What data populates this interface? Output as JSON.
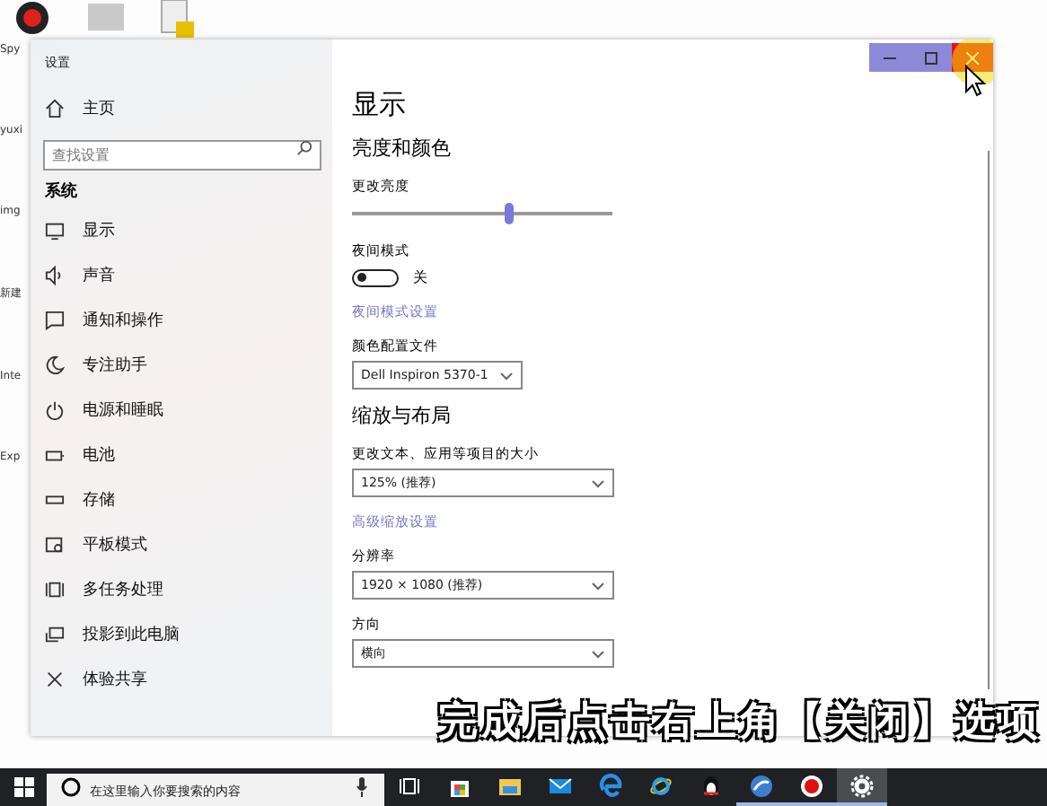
{
  "desktop": {
    "icon_labels": [
      "Spy",
      "yuxi",
      "img",
      "新建",
      "Inte",
      "Exp"
    ]
  },
  "window": {
    "title": "设置",
    "sidebar": {
      "home": "主页",
      "search_placeholder": "查找设置",
      "section": "系统",
      "items": [
        {
          "label": "显示"
        },
        {
          "label": "声音"
        },
        {
          "label": "通知和操作"
        },
        {
          "label": "专注助手"
        },
        {
          "label": "电源和睡眠"
        },
        {
          "label": "电池"
        },
        {
          "label": "存储"
        },
        {
          "label": "平板模式"
        },
        {
          "label": "多任务处理"
        },
        {
          "label": "投影到此电脑"
        },
        {
          "label": "体验共享"
        }
      ]
    },
    "content": {
      "title": "显示",
      "sections": [
        {
          "heading": "亮度和颜色",
          "controls": [
            {
              "kind": "slider",
              "label": "更改亮度",
              "level": 0.61
            },
            {
              "kind": "toggle",
              "label": "夜间模式",
              "on": false,
              "state_text": "关"
            },
            {
              "kind": "link",
              "text": "夜间模式设置"
            },
            {
              "kind": "dropdown",
              "label": "颜色配置文件",
              "value": "Dell Inspiron 5370-1",
              "wide": false
            }
          ]
        },
        {
          "heading": "缩放与布局",
          "controls": [
            {
              "kind": "dropdown",
              "label": "更改文本、应用等项目的大小",
              "value": "125% (推荐)",
              "wide": true
            },
            {
              "kind": "link",
              "text": "高级缩放设置"
            },
            {
              "kind": "dropdown",
              "label": "分辨率",
              "value": "1920 × 1080 (推荐)",
              "wide": true
            },
            {
              "kind": "dropdown",
              "label": "方向",
              "value": "横向",
              "wide": true
            }
          ]
        }
      ]
    }
  },
  "caption": "完成后点击右上角【关闭】选项",
  "taskbar": {
    "search_placeholder": "在这里输入你要搜索的内容",
    "apps": [
      {
        "running": false,
        "active": false
      },
      {
        "running": false,
        "active": false
      },
      {
        "running": false,
        "active": false
      },
      {
        "running": false,
        "active": false
      },
      {
        "running": false,
        "active": false
      },
      {
        "running": false,
        "active": false
      },
      {
        "running": true,
        "active": false
      },
      {
        "running": true,
        "active": false
      },
      {
        "running": true,
        "active": true
      }
    ]
  }
}
